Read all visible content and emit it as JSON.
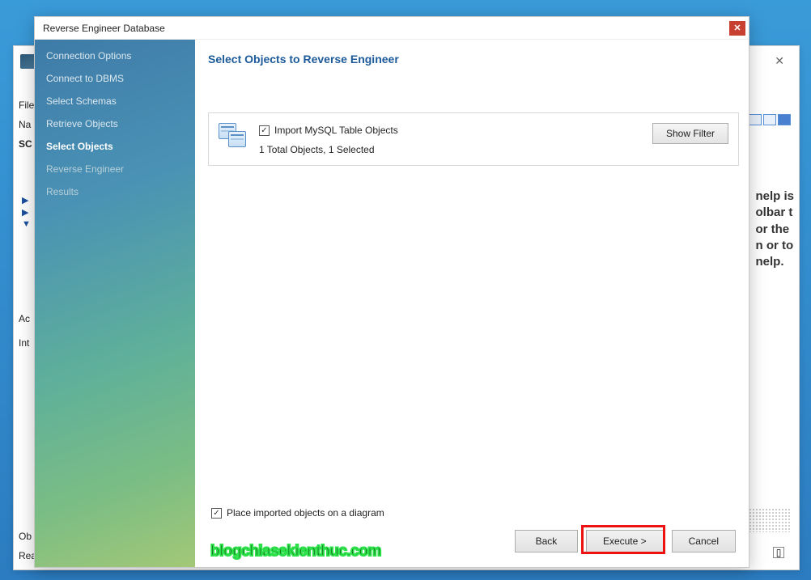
{
  "dialog": {
    "title": "Reverse Engineer Database"
  },
  "sidebar": {
    "items": [
      {
        "label": "Connection Options"
      },
      {
        "label": "Connect to DBMS"
      },
      {
        "label": "Select Schemas"
      },
      {
        "label": "Retrieve Objects"
      },
      {
        "label": "Select Objects"
      },
      {
        "label": "Reverse Engineer"
      },
      {
        "label": "Results"
      }
    ]
  },
  "main": {
    "heading": "Select Objects to Reverse Engineer",
    "import_label": "Import MySQL Table Objects",
    "count_text": "1 Total Objects, 1 Selected",
    "show_filter": "Show Filter",
    "place_diagram": "Place imported objects on a diagram"
  },
  "buttons": {
    "back": "Back",
    "execute": "Execute >",
    "cancel": "Cancel"
  },
  "bg": {
    "close": "✕",
    "file": "File",
    "na": "Na",
    "sc": "SC",
    "ac": "Ac",
    "int": "Int",
    "ob": "Ob",
    "rea": "Rea",
    "help1": "nelp is",
    "help2": "olbar t",
    "help3": "or the",
    "help4": "n or to",
    "help5": "nelp."
  },
  "watermark": "blogchiasekienthuc.com"
}
